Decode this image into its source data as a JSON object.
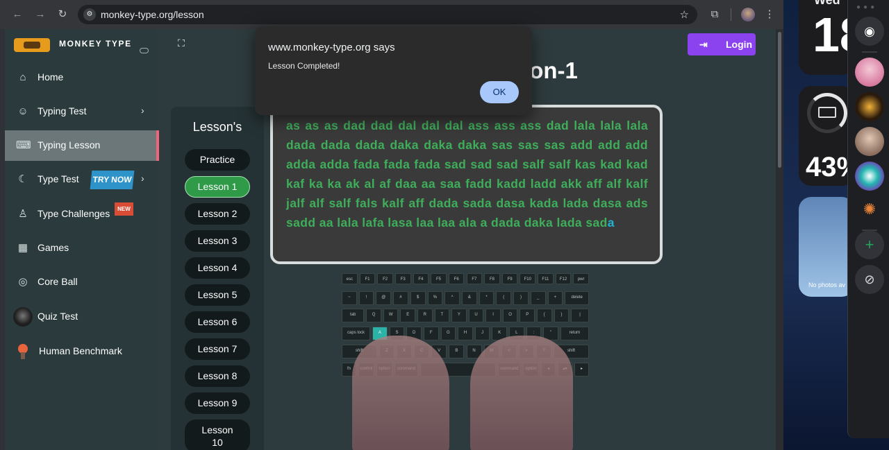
{
  "browser": {
    "url": "monkey-type.org/lesson",
    "back_icon": "←",
    "forward_icon": "→",
    "reload_icon": "↻"
  },
  "sidebar": {
    "brand": "MONKEY TYPE",
    "items": [
      {
        "label": "Home",
        "icon": "⌂"
      },
      {
        "label": "Typing Test",
        "icon": "☺"
      },
      {
        "label": "Typing Lesson",
        "icon": "⌨"
      },
      {
        "label": "Type Test",
        "icon": "☾",
        "badge": "TRY NOW"
      },
      {
        "label": "Type Challenges",
        "icon": "♙",
        "badge": "NEW"
      },
      {
        "label": "Games",
        "icon": "▦"
      },
      {
        "label": "Core Ball",
        "icon": "◎"
      },
      {
        "label": "Quiz Test",
        "icon": ""
      },
      {
        "label": "Human Benchmark",
        "icon": ""
      }
    ]
  },
  "header": {
    "login_label": "Login",
    "title": "Lesson-1"
  },
  "lessons": {
    "heading": "Lesson's",
    "buttons": [
      "Practice",
      "Lesson 1",
      "Lesson 2",
      "Lesson 3",
      "Lesson 4",
      "Lesson 5",
      "Lesson 6",
      "Lesson 7",
      "Lesson 8",
      "Lesson 9",
      "Lesson 10"
    ],
    "active": "Lesson 1"
  },
  "typing": {
    "typed": "as as as dad dad dal dal dal ass ass ass dad lala lala lala dada dada dada daka daka daka sas sas sas add add add adda adda fada fada fada sad sad sad salf salf kas kad kad kaf ka ka ak al af daa aa saa fadd kadd ladd akk aff alf kalf jalf alf salf fals kalf aff dada sada dasa kada lada dasa ads sadd aa lala lafa lasa laa laa ala a dada daka lada sad",
    "current": "a"
  },
  "keyboard": {
    "highlighted_key": "A",
    "rows": [
      [
        "esc",
        "F1",
        "F2",
        "F3",
        "F4",
        "F5",
        "F6",
        "F7",
        "F8",
        "F9",
        "F10",
        "F11",
        "F12",
        "pwr"
      ],
      [
        "~",
        "!",
        "@",
        "#",
        "$",
        "%",
        "^",
        "&",
        "*",
        "(",
        ")",
        "_",
        "+",
        "delete"
      ],
      [
        "tab",
        "Q",
        "W",
        "E",
        "R",
        "T",
        "Y",
        "U",
        "I",
        "O",
        "P",
        "{",
        "}",
        "|"
      ],
      [
        "caps lock",
        "A",
        "S",
        "D",
        "F",
        "G",
        "H",
        "J",
        "K",
        "L",
        ":",
        "\"",
        "return"
      ],
      [
        "shift",
        "Z",
        "X",
        "C",
        "V",
        "B",
        "N",
        "M",
        "<",
        ">",
        "?",
        "shift"
      ],
      [
        "fn",
        "control",
        "option",
        "command",
        "",
        "command",
        "option",
        "◂",
        "▴▾",
        "▸"
      ]
    ]
  },
  "dialog": {
    "title": "www.monkey-type.org says",
    "message": "Lesson Completed!",
    "ok_label": "OK"
  },
  "desktop": {
    "calendar_day": "Wed",
    "calendar_num": "18",
    "battery_pct": "43%",
    "photos_text": "No photos av"
  }
}
